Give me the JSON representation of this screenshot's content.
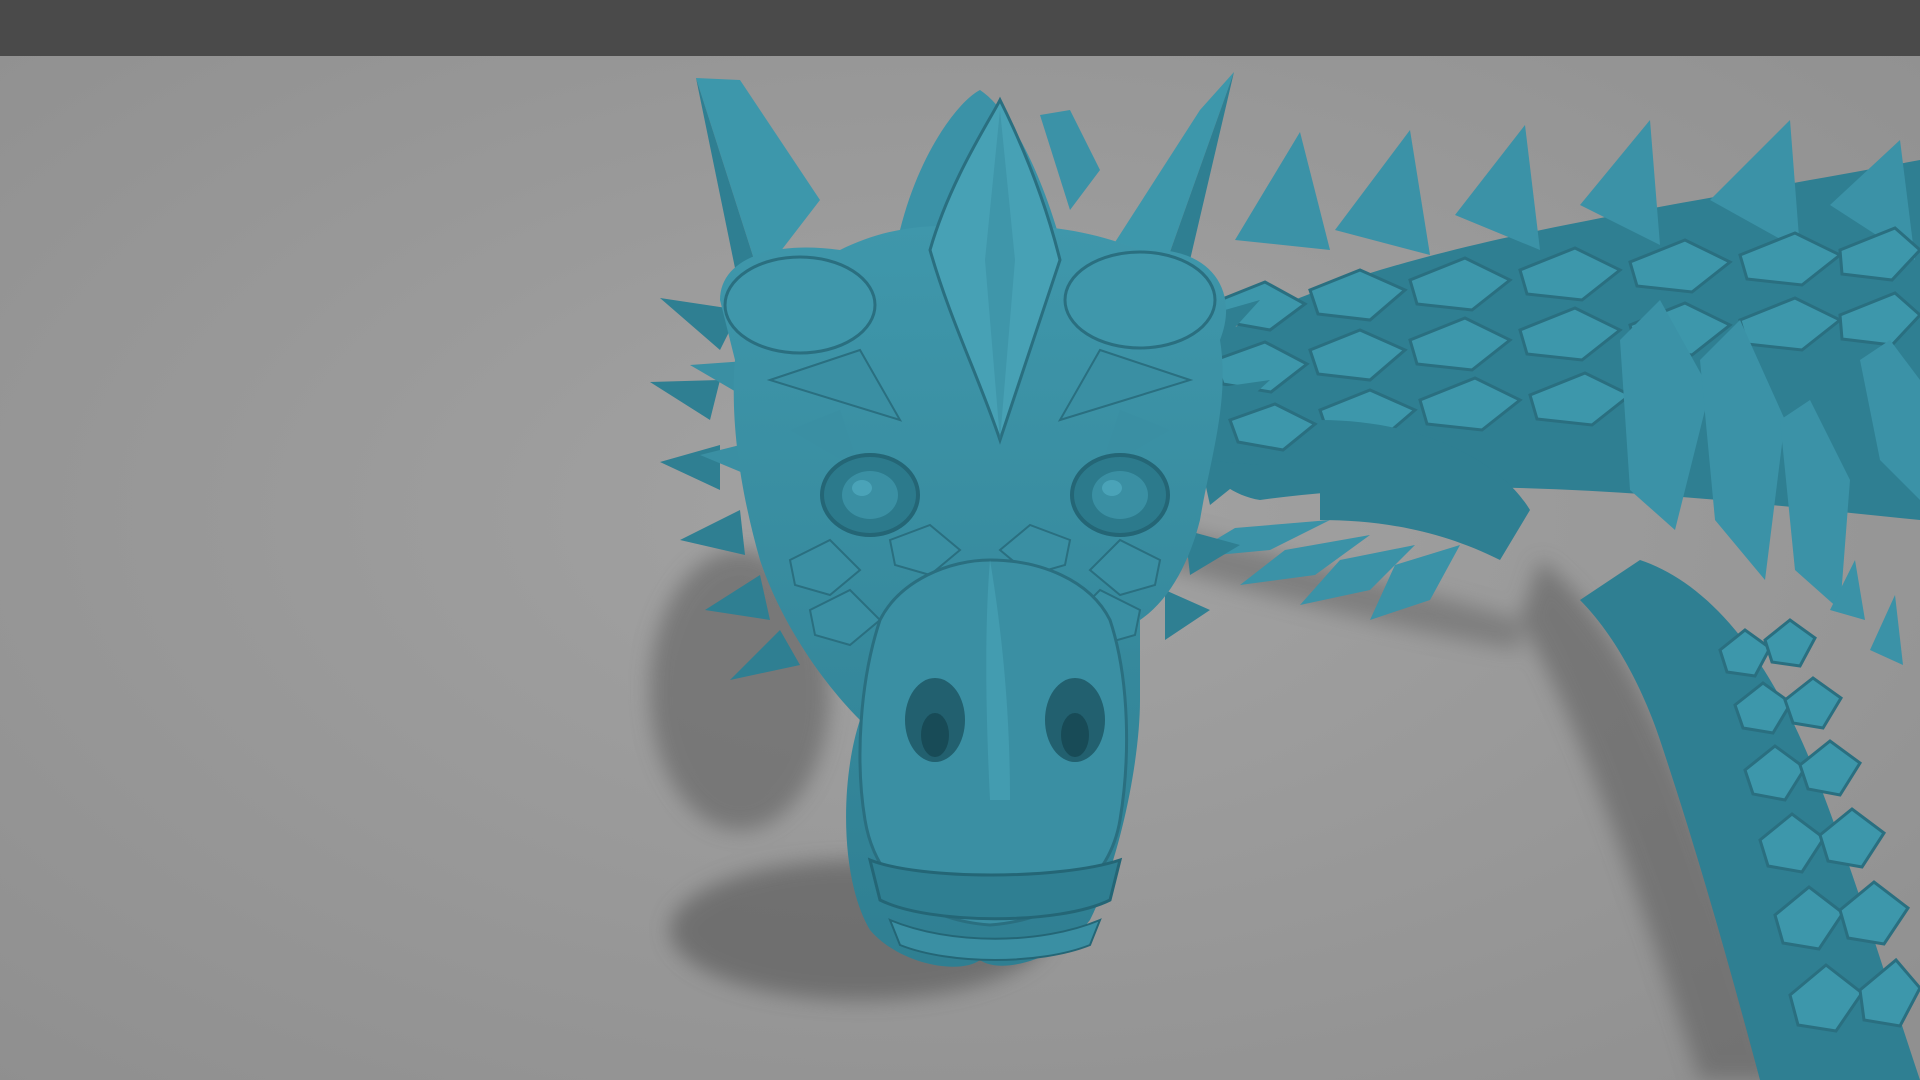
{
  "scene": {
    "subject": "dragon-model",
    "model_color": "#3a8fa3",
    "ground_color": "#9b9b9b",
    "top_bar_color": "#4a4a4a"
  }
}
